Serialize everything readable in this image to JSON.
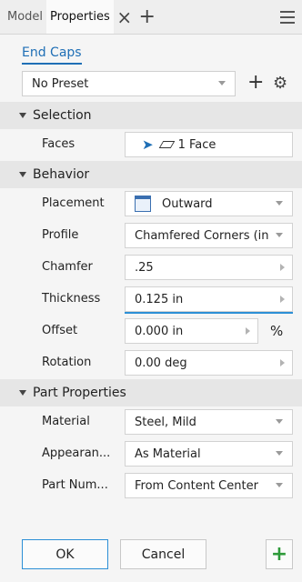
{
  "tabs": [
    {
      "label": "Model"
    },
    {
      "label": "Properties"
    }
  ],
  "subtab": {
    "label": "End Caps"
  },
  "preset": {
    "value": "No Preset"
  },
  "sections": {
    "selection": {
      "title": "Selection"
    },
    "behavior": {
      "title": "Behavior"
    },
    "part_properties": {
      "title": "Part Properties"
    }
  },
  "selection": {
    "faces": {
      "label": "Faces",
      "value": "1 Face"
    }
  },
  "behavior": {
    "placement": {
      "label": "Placement",
      "value": "Outward"
    },
    "profile": {
      "label": "Profile",
      "value": "Chamfered Corners (in"
    },
    "chamfer": {
      "label": "Chamfer",
      "value": ".25"
    },
    "thickness": {
      "label": "Thickness",
      "value": "0.125 in"
    },
    "offset": {
      "label": "Offset",
      "value": "0.000 in",
      "unit_symbol": "%"
    },
    "rotation": {
      "label": "Rotation",
      "value": "0.00 deg"
    }
  },
  "part_properties": {
    "material": {
      "label": "Material",
      "value": "Steel, Mild"
    },
    "appearance": {
      "label": "Appearan...",
      "value": "As Material"
    },
    "part_number": {
      "label": "Part Num...",
      "value": "From Content Center"
    }
  },
  "buttons": {
    "ok": "OK",
    "cancel": "Cancel"
  },
  "colors": {
    "accent": "#1f6fb6",
    "add_green": "#2e9a3a"
  }
}
